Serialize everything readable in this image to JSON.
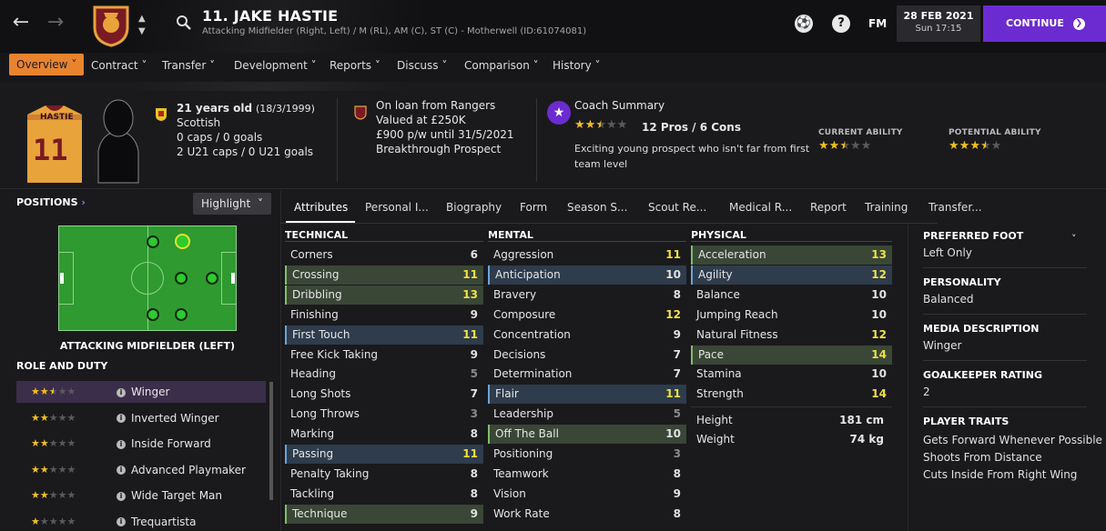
{
  "header": {
    "player_title": "11. JAKE HASTIE",
    "player_subtitle": "Attacking Midfielder (Right, Left) / M (RL), AM (C), ST (C) - Motherwell (ID:61074081)",
    "date": "28 FEB 2021",
    "time": "Sun 17:15",
    "fm_label": "FM",
    "help_label": "?",
    "continue_label": "CONTINUE",
    "accent_color": "#6b2bd1"
  },
  "menu": [
    {
      "label": "Overview",
      "active": true
    },
    {
      "label": "Contract"
    },
    {
      "label": "Transfer"
    },
    {
      "label": "Development"
    },
    {
      "label": "Reports"
    },
    {
      "label": "Discuss"
    },
    {
      "label": "Comparison"
    },
    {
      "label": "History"
    }
  ],
  "profile": {
    "shirt_name": "HASTIE",
    "shirt_number": "11",
    "age": "21 years old",
    "dob": "(18/3/1999)",
    "nationality": "Scottish",
    "caps": "0 caps / 0 goals",
    "u21": "2 U21 caps / 0 U21 goals",
    "loan": "On loan from Rangers",
    "value": "Valued at £250K",
    "wage": "£900 p/w until 31/5/2021",
    "status": "Breakthrough Prospect",
    "coach_title": "Coach Summary",
    "pros_cons": "12 Pros / 6 Cons",
    "coach_text_1": "Exciting young prospect who isn't far from first",
    "coach_text_2": "team level",
    "current_ability_label": "CURRENT ABILITY",
    "potential_ability_label": "POTENTIAL ABILITY",
    "coach_stars": 2.5,
    "current_stars": 2.5,
    "potential_stars": 3.5
  },
  "left": {
    "positions_label": "POSITIONS",
    "highlight_label": "Highlight",
    "position_name": "ATTACKING MIDFIELDER (LEFT)",
    "role_duty_label": "ROLE AND DUTY",
    "roles": [
      {
        "name": "Winger",
        "stars": 2.5
      },
      {
        "name": "Inverted Winger",
        "stars": 2
      },
      {
        "name": "Inside Forward",
        "stars": 2
      },
      {
        "name": "Advanced Playmaker",
        "stars": 2
      },
      {
        "name": "Wide Target Man",
        "stars": 2
      },
      {
        "name": "Trequartista",
        "stars": 1
      }
    ]
  },
  "tabs": [
    "Attributes",
    "Personal I...",
    "Biography",
    "Form",
    "Season S...",
    "Scout Re...",
    "Medical R...",
    "Report",
    "Training",
    "Transfer..."
  ],
  "attributes": {
    "technical_label": "TECHNICAL",
    "mental_label": "MENTAL",
    "physical_label": "PHYSICAL",
    "technical": [
      {
        "name": "Corners",
        "value": "6"
      },
      {
        "name": "Crossing",
        "value": "11",
        "hl": "green"
      },
      {
        "name": "Dribbling",
        "value": "13",
        "hl": "green"
      },
      {
        "name": "Finishing",
        "value": "9"
      },
      {
        "name": "First Touch",
        "value": "11",
        "hl": "blue"
      },
      {
        "name": "Free Kick Taking",
        "value": "9"
      },
      {
        "name": "Heading",
        "value": "5"
      },
      {
        "name": "Long Shots",
        "value": "7"
      },
      {
        "name": "Long Throws",
        "value": "3"
      },
      {
        "name": "Marking",
        "value": "8"
      },
      {
        "name": "Passing",
        "value": "11",
        "hl": "blue"
      },
      {
        "name": "Penalty Taking",
        "value": "8"
      },
      {
        "name": "Tackling",
        "value": "8"
      },
      {
        "name": "Technique",
        "value": "9",
        "hl": "green"
      }
    ],
    "mental": [
      {
        "name": "Aggression",
        "value": "11"
      },
      {
        "name": "Anticipation",
        "value": "10",
        "hl": "blue"
      },
      {
        "name": "Bravery",
        "value": "8"
      },
      {
        "name": "Composure",
        "value": "12"
      },
      {
        "name": "Concentration",
        "value": "9"
      },
      {
        "name": "Decisions",
        "value": "7"
      },
      {
        "name": "Determination",
        "value": "7"
      },
      {
        "name": "Flair",
        "value": "11",
        "hl": "blue"
      },
      {
        "name": "Leadership",
        "value": "5"
      },
      {
        "name": "Off The Ball",
        "value": "10",
        "hl": "green"
      },
      {
        "name": "Positioning",
        "value": "3"
      },
      {
        "name": "Teamwork",
        "value": "8"
      },
      {
        "name": "Vision",
        "value": "9"
      },
      {
        "name": "Work Rate",
        "value": "8"
      }
    ],
    "physical": [
      {
        "name": "Acceleration",
        "value": "13",
        "hl": "green"
      },
      {
        "name": "Agility",
        "value": "12",
        "hl": "blue"
      },
      {
        "name": "Balance",
        "value": "10"
      },
      {
        "name": "Jumping Reach",
        "value": "10"
      },
      {
        "name": "Natural Fitness",
        "value": "12"
      },
      {
        "name": "Pace",
        "value": "14",
        "hl": "green"
      },
      {
        "name": "Stamina",
        "value": "10"
      },
      {
        "name": "Strength",
        "value": "14"
      }
    ],
    "height_label": "Height",
    "height_value": "181 cm",
    "weight_label": "Weight",
    "weight_value": "74 kg"
  },
  "right": {
    "foot_label": "PREFERRED FOOT",
    "foot_value": "Left Only",
    "personality_label": "PERSONALITY",
    "personality_value": "Balanced",
    "media_label": "MEDIA DESCRIPTION",
    "media_value": "Winger",
    "gk_label": "GOALKEEPER RATING",
    "gk_value": "2",
    "traits_label": "PLAYER TRAITS",
    "traits": [
      "Gets Forward Whenever Possible",
      "Shoots From Distance",
      "Cuts Inside From Right Wing"
    ]
  }
}
